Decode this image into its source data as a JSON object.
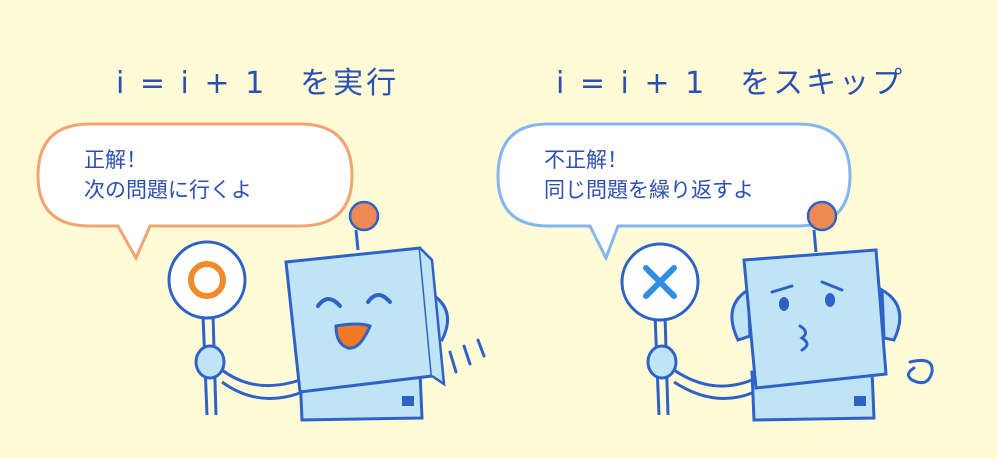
{
  "left": {
    "heading": "i = i + 1　を実行",
    "bubble_line1": "正解！",
    "bubble_line2": "次の問題に行くよ",
    "sign_icon": "circle-mark-icon",
    "robot_expression": "happy"
  },
  "right": {
    "heading": "i = i + 1　をスキップ",
    "bubble_line1": "不正解！",
    "bubble_line2": "同じ問題を繰り返すよ",
    "sign_icon": "cross-mark-icon",
    "robot_expression": "puzzled"
  },
  "colors": {
    "background": "#fefbd6",
    "text": "#2b4fb3",
    "robot_fill": "#bfe4f5",
    "robot_outline": "#2f62c9",
    "bubble_left_border": "#f2a472",
    "bubble_right_border": "#86b6ef",
    "antenna": "#f08a54",
    "circle_mark": "#f08a2a",
    "cross_mark": "#2e8fe0",
    "mouth": "#f27a24"
  }
}
